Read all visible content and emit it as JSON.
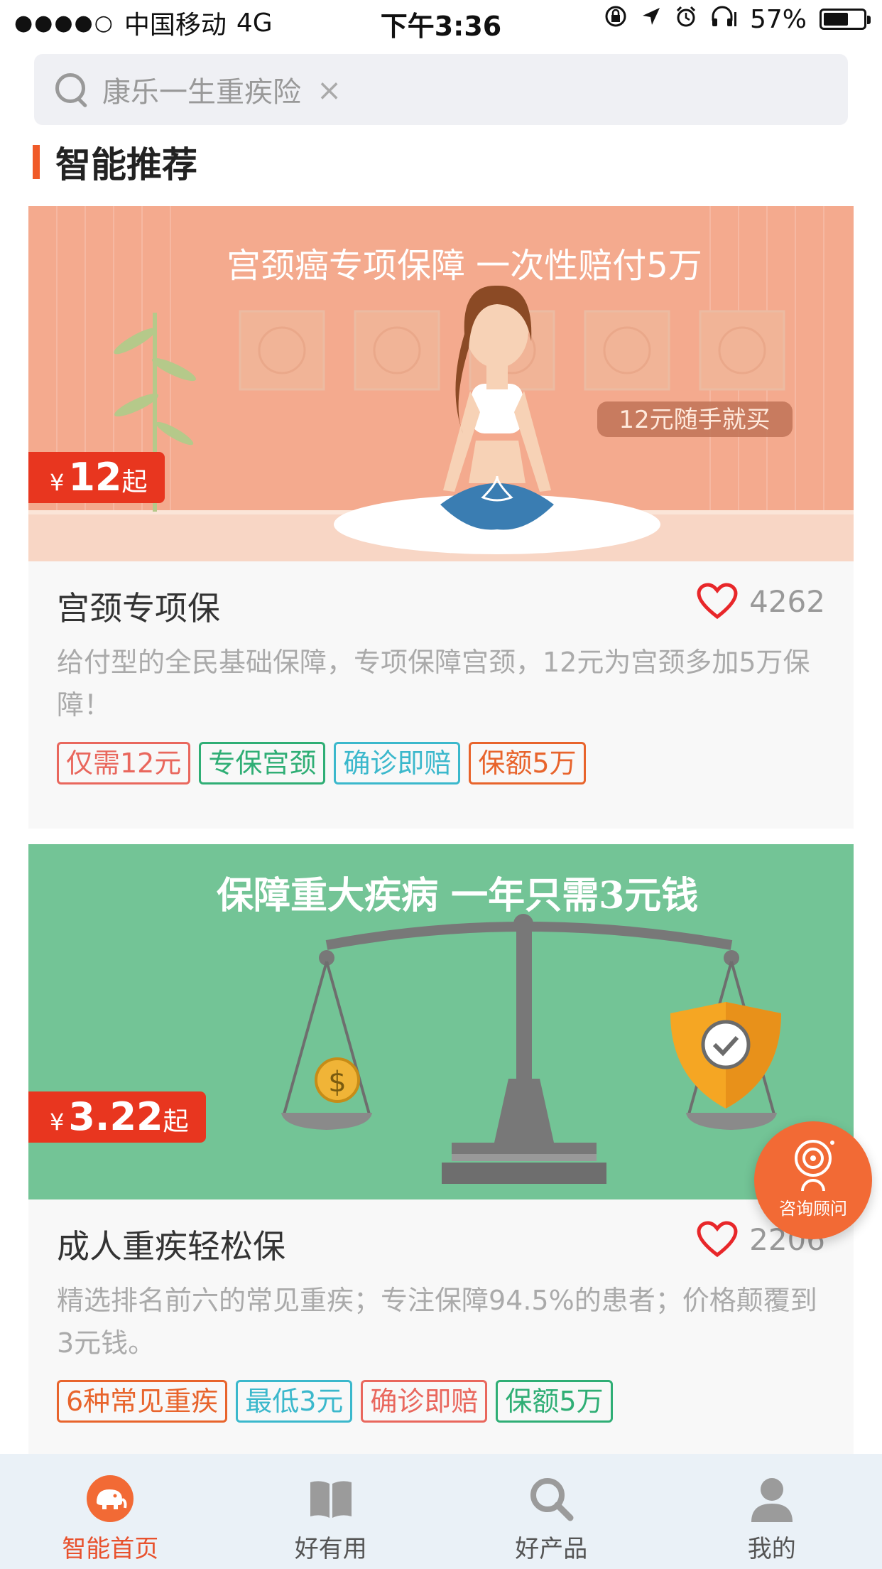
{
  "status_bar": {
    "carrier": "中国移动",
    "network": "4G",
    "time": "下午3:36",
    "battery": "57%"
  },
  "search": {
    "query": "康乐一生重疾险",
    "clear_glyph": "×"
  },
  "section": {
    "title": "智能推荐"
  },
  "products": [
    {
      "banner_headline": "宫颈癌专项保障 一次性赔付5万",
      "banner_pill": "12元随手就买",
      "banner_color": "#f4aa8e",
      "price_currency": "¥",
      "price_amount": "12",
      "price_suffix": "起",
      "name": "宫颈专项保",
      "likes": "4262",
      "description": "给付型的全民基础保障，专项保障宫颈，12元为宫颈多加5万保障！",
      "tags": [
        {
          "label": "仅需12元",
          "color": "#e9675d"
        },
        {
          "label": "专保宫颈",
          "color": "#2fae75"
        },
        {
          "label": "确诊即赔",
          "color": "#3bb8cc"
        },
        {
          "label": "保额5万",
          "color": "#e8642c"
        }
      ]
    },
    {
      "banner_headline": "保障重大疾病   一年只需3元钱",
      "banner_color": "#73c496",
      "price_currency": "¥",
      "price_amount": "3.22",
      "price_suffix": "起",
      "name": "成人重疾轻松保",
      "likes": "2206",
      "description": "精选排名前六的常见重疾；专注保障94.5%的患者；价格颠覆到3元钱。",
      "tags": [
        {
          "label": "6种常见重疾",
          "color": "#e8642c"
        },
        {
          "label": "最低3元",
          "color": "#3bb8cc"
        },
        {
          "label": "确诊即赔",
          "color": "#e9675d"
        },
        {
          "label": "保额5万",
          "color": "#2fae75"
        }
      ]
    }
  ],
  "consult_button": {
    "label": "咨询顾问"
  },
  "bottom_nav": {
    "items": [
      {
        "label": "智能首页",
        "icon": "elephant-home-icon",
        "active": true
      },
      {
        "label": "好有用",
        "icon": "book-icon",
        "active": false
      },
      {
        "label": "好产品",
        "icon": "search-icon",
        "active": false
      },
      {
        "label": "我的",
        "icon": "person-icon",
        "active": false
      }
    ]
  },
  "colors": {
    "accent": "#e8361f",
    "section_bar": "#f05a28",
    "nav_active": "#e8512d"
  }
}
